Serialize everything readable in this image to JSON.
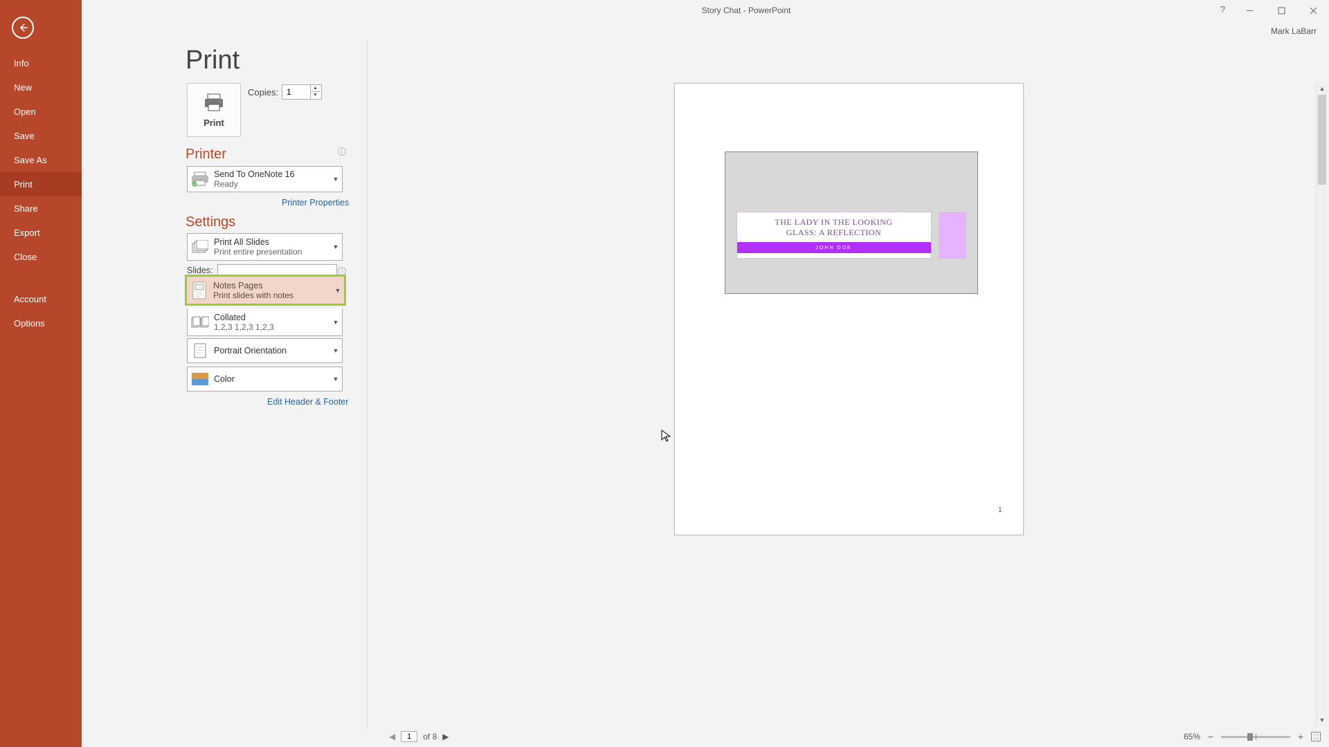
{
  "window": {
    "title": "Story Chat - PowerPoint",
    "user": "Mark LaBarr"
  },
  "sidebar": {
    "items": [
      "Info",
      "New",
      "Open",
      "Save",
      "Save As",
      "Print",
      "Share",
      "Export",
      "Close"
    ],
    "selected": "Print",
    "bottom": [
      "Account",
      "Options"
    ]
  },
  "page": {
    "title": "Print"
  },
  "print_button": {
    "label": "Print"
  },
  "copies": {
    "label": "Copies:",
    "value": "1"
  },
  "printer": {
    "section": "Printer",
    "name": "Send To OneNote 16",
    "status": "Ready",
    "properties_link": "Printer Properties"
  },
  "settings": {
    "section": "Settings",
    "what": {
      "line1": "Print All Slides",
      "line2": "Print entire presentation"
    },
    "slides_label": "Slides:",
    "slides_value": "",
    "layout": {
      "line1": "Notes Pages",
      "line2": "Print slides with notes"
    },
    "collate": {
      "line1": "Collated",
      "line2": "1,2,3    1,2,3    1,2,3"
    },
    "orientation": "Portrait Orientation",
    "color": "Color",
    "edit_hf": "Edit Header & Footer"
  },
  "preview": {
    "slide_title_l1": "THE LADY IN THE LOOKING",
    "slide_title_l2": "GLASS: A REFLECTION",
    "subtitle": "JOHN DOE",
    "page_number": "1"
  },
  "footer": {
    "current_page": "1",
    "total_pages": "of 8",
    "zoom": "65%"
  }
}
